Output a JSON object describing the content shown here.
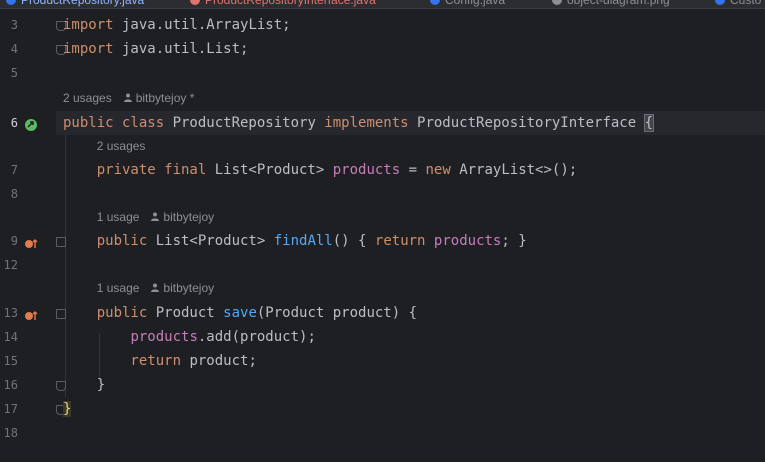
{
  "tabs": [
    {
      "label": "ProductRepository.java",
      "state": "active",
      "color": "#3574f0"
    },
    {
      "label": "ProductRepositoryInterface.java",
      "state": "error",
      "color": "#e0736c"
    },
    {
      "label": "Config.java",
      "state": "normal",
      "color": "#3574f0"
    },
    {
      "label": "object-diagram.png",
      "state": "normal",
      "color": "#8c8f96"
    },
    {
      "label": "Custo",
      "state": "normal",
      "color": "#3574f0"
    }
  ],
  "editor": {
    "lines": [
      {
        "num": "3",
        "code": [
          {
            "t": "import",
            "c": "kw"
          },
          {
            "t": " java.util.ArrayList;",
            "c": "cls"
          }
        ]
      },
      {
        "num": "4",
        "code": [
          {
            "t": "import",
            "c": "kw"
          },
          {
            "t": " java.util.List;",
            "c": "cls"
          }
        ]
      },
      {
        "num": "5",
        "code": []
      },
      {
        "hint": {
          "usages": "2 usages",
          "author": "bitbytejoy *"
        }
      },
      {
        "num": "6",
        "current": true,
        "code": [
          {
            "t": "public class ",
            "c": "kw"
          },
          {
            "t": "ProductRepository ",
            "c": "cls"
          },
          {
            "t": "implements ",
            "c": "kw"
          },
          {
            "t": "ProductRepositoryInterface ",
            "c": "cls"
          },
          {
            "t": "{",
            "c": "brace"
          }
        ]
      },
      {
        "hint": {
          "usages": "2 usages",
          "author": ""
        }
      },
      {
        "num": "7",
        "code": [
          {
            "t": "    private final ",
            "c": "kw"
          },
          {
            "t": "List<Product> ",
            "c": "cls"
          },
          {
            "t": "products",
            "c": "fld"
          },
          {
            "t": " = ",
            "c": "cls"
          },
          {
            "t": "new ",
            "c": "kw"
          },
          {
            "t": "ArrayList<>();",
            "c": "cls"
          }
        ]
      },
      {
        "num": "8",
        "code": []
      },
      {
        "hint": {
          "usages": "1 usage",
          "author": "bitbytejoy"
        }
      },
      {
        "num": "9",
        "code": [
          {
            "t": "    public ",
            "c": "kw"
          },
          {
            "t": "List<Product> ",
            "c": "cls"
          },
          {
            "t": "findAll",
            "c": "fn"
          },
          {
            "t": "() { ",
            "c": "cls"
          },
          {
            "t": "return ",
            "c": "kw"
          },
          {
            "t": "products",
            "c": "fld"
          },
          {
            "t": "; }",
            "c": "cls"
          }
        ]
      },
      {
        "num": "12",
        "code": []
      },
      {
        "hint": {
          "usages": "1 usage",
          "author": "bitbytejoy"
        }
      },
      {
        "num": "13",
        "code": [
          {
            "t": "    public ",
            "c": "kw"
          },
          {
            "t": "Product ",
            "c": "cls"
          },
          {
            "t": "save",
            "c": "fn"
          },
          {
            "t": "(Product product) {",
            "c": "cls"
          }
        ]
      },
      {
        "num": "14",
        "code": [
          {
            "t": "        ",
            "c": "cls"
          },
          {
            "t": "products",
            "c": "fld"
          },
          {
            "t": ".add(product);",
            "c": "cls"
          }
        ]
      },
      {
        "num": "15",
        "code": [
          {
            "t": "        return ",
            "c": "kw"
          },
          {
            "t": "product;",
            "c": "cls"
          }
        ]
      },
      {
        "num": "16",
        "code": [
          {
            "t": "    }",
            "c": "cls"
          }
        ]
      },
      {
        "num": "17",
        "code": [
          {
            "t": "}",
            "c": "brace2"
          }
        ]
      },
      {
        "num": "18",
        "code": []
      }
    ]
  },
  "colors": {
    "background": "#1e1f22",
    "keyword": "#cf8e6d",
    "method": "#56a8f5",
    "field": "#c77dbb",
    "text": "#bcbec4",
    "line_number": "#6f737a",
    "run_icon": "#5fb865",
    "override_icon": "#e07c4c"
  }
}
